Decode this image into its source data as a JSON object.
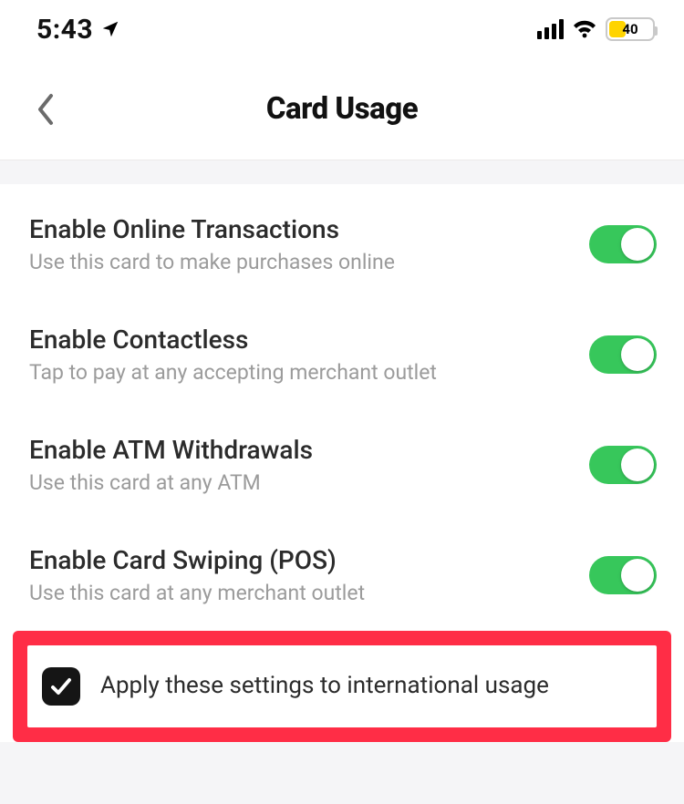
{
  "status_bar": {
    "time": "5:43",
    "battery_percent": "40",
    "battery_fill_pct": 40
  },
  "nav": {
    "title": "Card Usage"
  },
  "settings": [
    {
      "key": "online",
      "title": "Enable Online Transactions",
      "subtitle": "Use this card to make purchases online",
      "enabled": true
    },
    {
      "key": "contactless",
      "title": "Enable Contactless",
      "subtitle": "Tap to pay at any accepting merchant outlet",
      "enabled": true
    },
    {
      "key": "atm",
      "title": "Enable ATM Withdrawals",
      "subtitle": "Use this card at any ATM",
      "enabled": true
    },
    {
      "key": "pos",
      "title": "Enable Card Swiping (POS)",
      "subtitle": "Use this card at any merchant outlet",
      "enabled": true
    }
  ],
  "international": {
    "label": "Apply these settings to international usage",
    "checked": true
  },
  "colors": {
    "toggle_on": "#37c75b",
    "highlight": "#ff2d46",
    "battery_fill": "#ffd400"
  }
}
